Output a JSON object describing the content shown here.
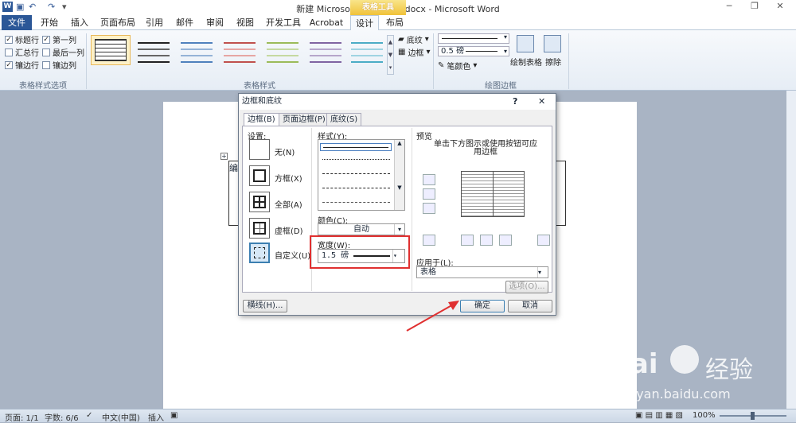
{
  "window": {
    "title": "新建 Microsoft Word 文档.docx - Microsoft Word",
    "context_tab": "表格工具"
  },
  "tabs": [
    {
      "label": "文件"
    },
    {
      "label": "开始"
    },
    {
      "label": "插入"
    },
    {
      "label": "页面布局"
    },
    {
      "label": "引用"
    },
    {
      "label": "邮件"
    },
    {
      "label": "审阅"
    },
    {
      "label": "视图"
    },
    {
      "label": "开发工具"
    },
    {
      "label": "Acrobat"
    },
    {
      "label": "设计"
    },
    {
      "label": "布局"
    }
  ],
  "ribbon": {
    "style_options": {
      "label": "表格样式选项",
      "items": [
        {
          "label": "标题行",
          "checked": true
        },
        {
          "label": "第一列",
          "checked": true
        },
        {
          "label": "汇总行",
          "checked": false
        },
        {
          "label": "最后一列",
          "checked": false
        },
        {
          "label": "镶边行",
          "checked": true
        },
        {
          "label": "镶边列",
          "checked": false
        }
      ]
    },
    "table_styles": {
      "label": "表格样式",
      "shading": "底纹",
      "borders": "边框"
    },
    "draw_borders": {
      "label": "绘图边框",
      "weight": "0.5 磅",
      "pen_color": "笔颜色",
      "draw_table": "绘制表格",
      "eraser": "擦除"
    }
  },
  "dialog": {
    "title": "边框和底纹",
    "help": "?",
    "close": "✕",
    "tabs": [
      "边框(B)",
      "页面边框(P)",
      "底纹(S)"
    ],
    "settings_label": "设置:",
    "settings": [
      "无(N)",
      "方框(X)",
      "全部(A)",
      "虚框(D)",
      "自定义(U)"
    ],
    "style_label": "样式(Y):",
    "color_label": "颜色(C):",
    "color_value": "自动",
    "width_label": "宽度(W):",
    "width_value": "1.5 磅",
    "preview_label": "预览",
    "preview_hint": "单击下方图示或使用按钮可应用边框",
    "apply_label": "应用于(L):",
    "apply_value": "表格",
    "options_btn": "选项(O)...",
    "hline_btn": "横线(H)...",
    "ok_btn": "确定",
    "cancel_btn": "取消"
  },
  "document": {
    "cell_text": "编"
  },
  "status": {
    "page": "页面: 1/1",
    "words": "字数: 6/6",
    "lang": "中文(中国)",
    "mode": "插入",
    "zoom": "100%"
  },
  "watermark": {
    "brand": "Bai",
    "brand2": "经验",
    "url": "jingyan.baidu.com"
  },
  "colors": {
    "accent": "#2b5797",
    "highlight": "#e03030",
    "tabletools": "#f0c23a"
  }
}
